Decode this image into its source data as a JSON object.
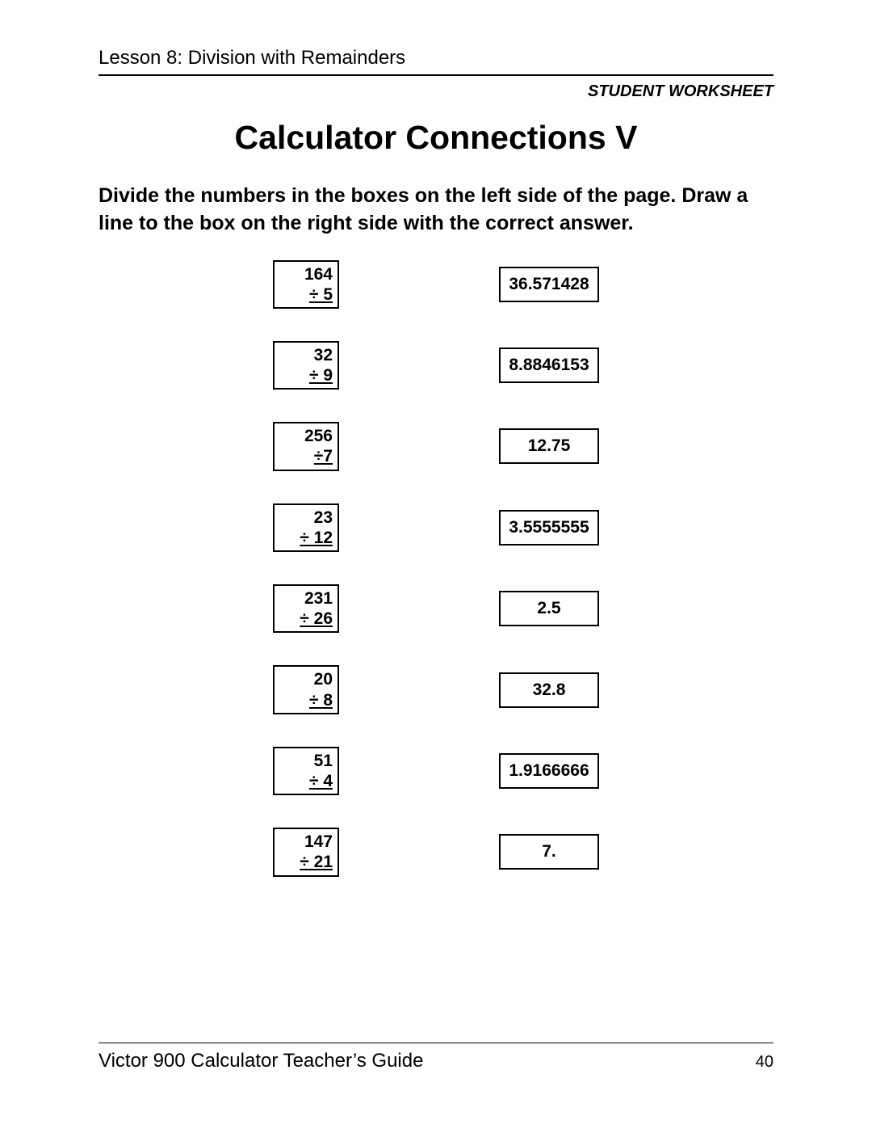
{
  "header": {
    "lesson": "Lesson 8:  Division with Remainders",
    "worksheet_label": "STUDENT WORKSHEET"
  },
  "title": "Calculator Connections V",
  "instructions": "Divide the numbers in the boxes on the left side of the page.  Draw a line to the box on the right side with the correct answer.",
  "rows": [
    {
      "dividend": "164",
      "divisor": "÷  5",
      "answer": "36.571428"
    },
    {
      "dividend": "32",
      "divisor": "÷  9",
      "answer": "8.8846153"
    },
    {
      "dividend": "256",
      "divisor": "÷7",
      "answer": "12.75"
    },
    {
      "dividend": "23",
      "divisor": "÷  12",
      "answer": "3.5555555"
    },
    {
      "dividend": "231",
      "divisor": "÷  26",
      "answer": "2.5"
    },
    {
      "dividend": "20",
      "divisor": "÷ 8",
      "answer": "32.8"
    },
    {
      "dividend": "51",
      "divisor": "÷  4",
      "answer": "1.9166666"
    },
    {
      "dividend": "147",
      "divisor": "÷ 21",
      "answer": "7."
    }
  ],
  "footer": {
    "guide": "Victor 900 Calculator Teacher’s Guide",
    "page": "40"
  },
  "chart_data": {
    "type": "table",
    "columns": [
      "dividend",
      "divisor",
      "answer"
    ],
    "rows": [
      [
        164,
        5,
        "36.571428"
      ],
      [
        32,
        9,
        "8.8846153"
      ],
      [
        256,
        7,
        "12.75"
      ],
      [
        23,
        12,
        "3.5555555"
      ],
      [
        231,
        26,
        "2.5"
      ],
      [
        20,
        8,
        "32.8"
      ],
      [
        51,
        4,
        "1.9166666"
      ],
      [
        147,
        21,
        "7."
      ]
    ]
  }
}
